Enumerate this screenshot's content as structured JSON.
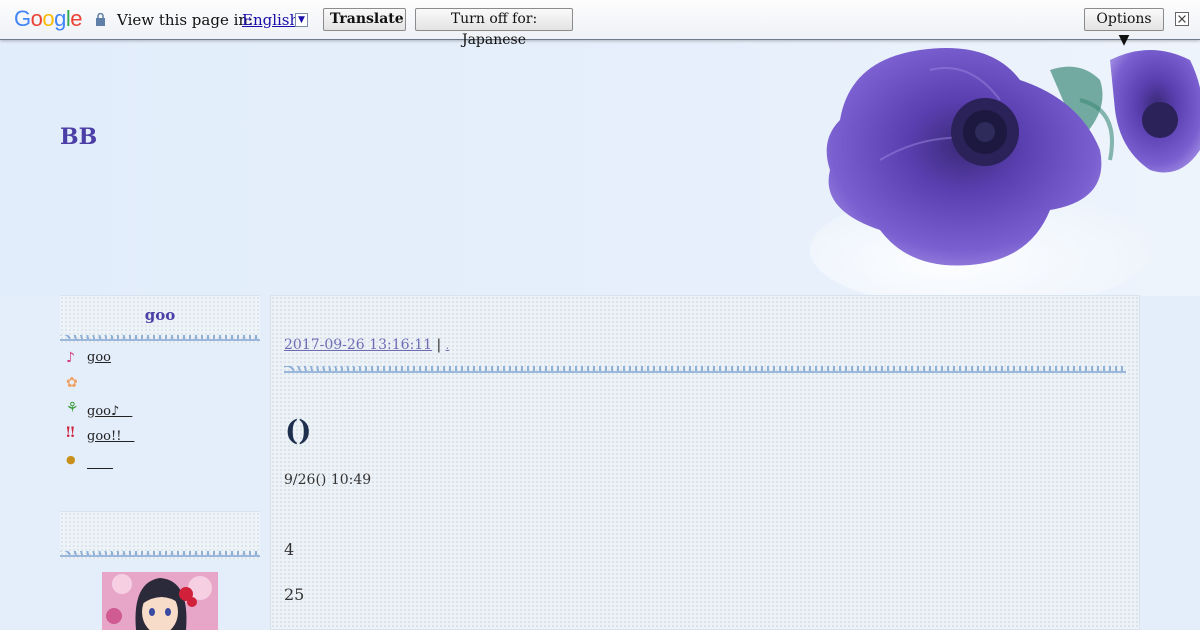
{
  "translate_bar": {
    "logo": "Google",
    "prompt": "View this page in:",
    "language": "English",
    "translate_button": "Translate",
    "turn_off_button": "Turn off for: Japanese",
    "options_button": "Options ▼"
  },
  "blog": {
    "title": "BB"
  },
  "sidebar": {
    "box1_heading": "goo",
    "items": [
      {
        "icon": "music-note-icon",
        "label": "goo"
      },
      {
        "icon": "flower-icon",
        "label": ""
      },
      {
        "icon": "sprout-icon",
        "label": "goo♪＿"
      },
      {
        "icon": "exclamation-icon",
        "label": "goo!!＿"
      },
      {
        "icon": "acorn-icon",
        "label": "＿＿"
      }
    ],
    "box2_heading": ""
  },
  "post": {
    "date": "2017-09-26 13:16:11",
    "separator": "|",
    "category": ".",
    "title": "()",
    "time": "9/26() 10:49",
    "line1": "4",
    "line2": "25"
  },
  "colors": {
    "accent_purple": "#4b3ea6",
    "link_purple": "#6e6db4",
    "background": "#e4eefb"
  }
}
